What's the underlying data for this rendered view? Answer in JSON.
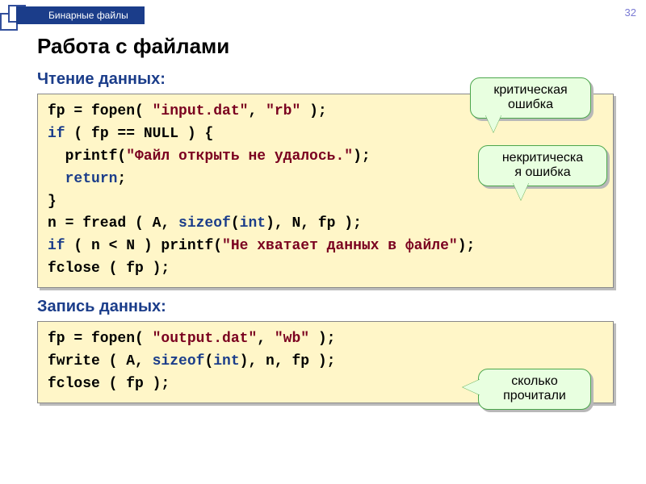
{
  "header": {
    "tab": "Бинарные файлы",
    "page_number": "32"
  },
  "title": "Работа с файлами",
  "read": {
    "heading": "Чтение данных:",
    "code": {
      "l1a": "fp = fopen( ",
      "l1b": "\"input.dat\"",
      "l1c": ", ",
      "l1d": "\"rb\"",
      "l1e": " );",
      "l2a": "if",
      "l2b": " ( fp == NULL ) {",
      "l3a": "  printf(",
      "l3b": "\"Файл открыть не удалось.\"",
      "l3c": ");",
      "l4a": "  ",
      "l4b": "return",
      "l4c": ";",
      "l5": "}",
      "l6a": "n = fread ( A, ",
      "l6b": "sizeof",
      "l6c": "(",
      "l6d": "int",
      "l6e": "), N, fp );",
      "l7a": "if",
      "l7b": " ( n < N ) printf(",
      "l7c": "\"Не хватает данных в файле\"",
      "l7d": ");",
      "l8": "fclose ( fp );"
    }
  },
  "write": {
    "heading": "Запись данных:",
    "code": {
      "l1a": "fp = fopen( ",
      "l1b": "\"output.dat\"",
      "l1c": ", ",
      "l1d": "\"wb\"",
      "l1e": " );",
      "l2a": "fwrite ( A, ",
      "l2b": "sizeof",
      "l2c": "(",
      "l2d": "int",
      "l2e": "), n, fp );",
      "l3": "fclose ( fp );"
    }
  },
  "callouts": {
    "critical": "критическая\nошибка",
    "noncritical": "некритическа\nя ошибка",
    "howmany": "сколько\nпрочитали"
  }
}
